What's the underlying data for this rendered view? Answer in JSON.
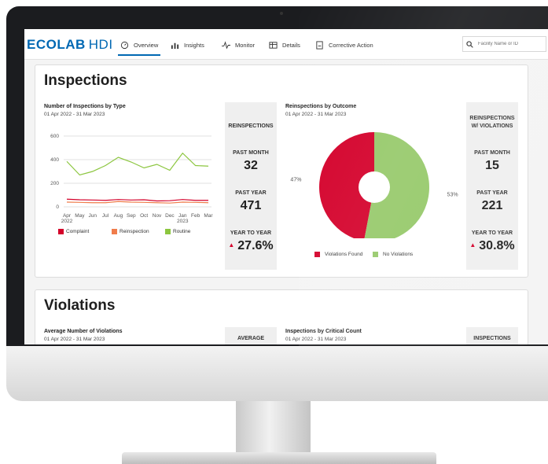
{
  "nav": {
    "logo_brand": "ECOLAB",
    "logo_product": "HDI",
    "tabs": [
      {
        "label": "Overview",
        "icon": "gauge-icon",
        "active": true
      },
      {
        "label": "Insights",
        "icon": "bar-chart-icon",
        "active": false
      },
      {
        "label": "Monitor",
        "icon": "pulse-icon",
        "active": false
      },
      {
        "label": "Details",
        "icon": "table-icon",
        "active": false
      },
      {
        "label": "Corrective Action",
        "icon": "document-icon",
        "active": false
      }
    ],
    "search_placeholder": "Facility Name or ID"
  },
  "inspections": {
    "title": "Inspections",
    "by_type": {
      "title": "Number of Inspections by Type",
      "date_range": "01 Apr 2022 - 31 Mar 2023"
    },
    "reinspections_stats": {
      "header": "REINSPECTIONS",
      "past_month_label": "PAST MONTH",
      "past_month_value": "32",
      "past_year_label": "PAST YEAR",
      "past_year_value": "471",
      "yoy_label": "YEAR TO YEAR",
      "yoy_value": "27.6%"
    },
    "by_outcome": {
      "title": "Reinspections by Outcome",
      "date_range": "01 Apr 2022 - 31 Mar 2023"
    },
    "violations_stats": {
      "header_line1": "REINSPECTIONS",
      "header_line2": "W/ VIOLATIONS",
      "past_month_label": "PAST MONTH",
      "past_month_value": "15",
      "past_year_label": "PAST YEAR",
      "past_year_value": "221",
      "yoy_label": "YEAR TO YEAR",
      "yoy_value": "30.8%"
    }
  },
  "violations": {
    "title": "Violations",
    "avg_title": "Average Number of Violations",
    "avg_date": "01 Apr 2022 - 31 Mar 2023",
    "avg_stat_header": "AVERAGE",
    "critical_title": "Inspections by Critical Count",
    "critical_date": "01 Apr 2022 - 31 Mar 2023",
    "critical_stat_header": "INSPECTIONS"
  },
  "chart_data": [
    {
      "type": "line",
      "title": "Number of Inspections by Type",
      "x": [
        "Apr",
        "May",
        "Jun",
        "Jul",
        "Aug",
        "Sep",
        "Oct",
        "Nov",
        "Dec",
        "Jan",
        "Feb",
        "Mar"
      ],
      "x_year_labels": {
        "0": "2022",
        "9": "2023"
      },
      "ylim": [
        0,
        600
      ],
      "yticks": [
        0,
        200,
        400,
        600
      ],
      "grid": true,
      "legend_position": "bottom",
      "series": [
        {
          "name": "Complaint",
          "color": "#d4002a",
          "values": [
            65,
            60,
            58,
            55,
            62,
            58,
            60,
            50,
            52,
            62,
            55,
            55
          ]
        },
        {
          "name": "Reinspection",
          "color": "#f07c4b",
          "values": [
            40,
            38,
            35,
            35,
            45,
            40,
            38,
            35,
            32,
            40,
            38,
            35
          ]
        },
        {
          "name": "Routine",
          "color": "#8cc63f",
          "values": [
            385,
            270,
            300,
            350,
            420,
            380,
            330,
            360,
            310,
            455,
            350,
            345
          ]
        }
      ]
    },
    {
      "type": "pie",
      "title": "Reinspections by Outcome",
      "donut": true,
      "legend_position": "bottom",
      "slices": [
        {
          "name": "Violations Found",
          "value": 47,
          "label": "47%",
          "color": "#d4002a"
        },
        {
          "name": "No Violations",
          "value": 53,
          "label": "53%",
          "color": "#96c96a"
        }
      ]
    }
  ]
}
